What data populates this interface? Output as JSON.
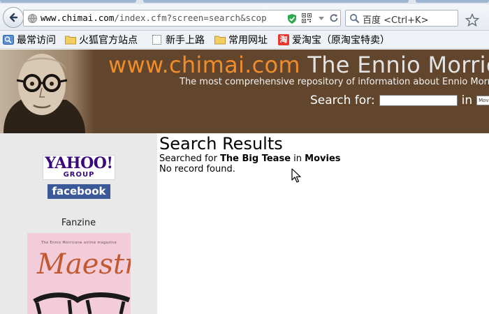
{
  "browser": {
    "url": {
      "scheme_host": "www.chimai.com",
      "path": "/index.cfm?screen=search&scop"
    },
    "search_placeholder": "百度 <Ctrl+K>",
    "bookmarks": [
      {
        "label": "最常访问",
        "icon": "most-visited-icon"
      },
      {
        "label": "火狐官方站点",
        "icon": "folder-icon"
      },
      {
        "label": "新手上路",
        "icon": "page-icon"
      },
      {
        "label": "常用网址",
        "icon": "folder-icon"
      },
      {
        "label": "爱淘宝（原淘宝特卖）",
        "icon": "taobao-icon"
      }
    ],
    "taobao_glyph": "淘"
  },
  "site": {
    "title_domain": "www.chimai.com",
    "title_rest": " The Ennio Morricone",
    "tagline": "The most comprehensive repository of information about Ennio Morricone",
    "search_label": "Search for:",
    "search_in": "in",
    "scope_selected": "Movies",
    "colors": {
      "header_bg": "#61452c",
      "domain": "#f08c2a",
      "sidebar_bg": "#e9e9e9"
    }
  },
  "sidebar": {
    "yahoo_logo": "YAHOO!",
    "yahoo_group": "GROUP",
    "facebook": "facebook",
    "fanzine_label": "Fanzine",
    "fanzine_header": "The Ennio Morricone online magazine",
    "fanzine_title": "Maestro"
  },
  "results": {
    "title": "Search Results",
    "searched_for": "Searched for",
    "query": "The Big Tease",
    "in_word": "in",
    "category": "Movies",
    "message": "No record found."
  }
}
